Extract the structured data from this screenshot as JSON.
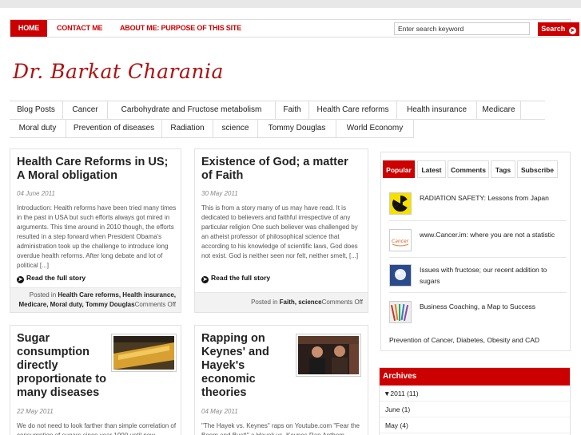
{
  "nav": {
    "home": "HOME",
    "contact": "CONTACT ME",
    "about": "ABOUT ME: PURPOSE OF THIS SITE",
    "search_placeholder": "Enter search keyword",
    "search_button": "Search"
  },
  "site_title": "Dr. Barkat Charania",
  "categories_row1": [
    "Blog Posts",
    "Cancer",
    "Carbohydrate and Fructose metabolism",
    "Faith",
    "Health Care reforms",
    "Health insurance",
    "Medicare"
  ],
  "categories_row2": [
    "Moral duty",
    "Prevention of diseases",
    "Radiation",
    "science",
    "Tommy Douglas",
    "World Economy"
  ],
  "posts": [
    {
      "title": "Health Care Reforms in US; A Moral obligation",
      "date": "04 June 2011",
      "excerpt": "Introduction: Health reforms have been tried many times in the past in USA but such efforts always got mired in arguments. This time around in 2010 though, the efforts resulted in a step forward when President Obama's administration took up the challenge to introduce long overdue health reforms. After long debate and lot of political [...]",
      "read_more": "Read the full story",
      "meta_prefix": "Posted in",
      "meta_cats": "Health Care reforms, Health insurance, Medicare, Moral duty, Tommy Douglas",
      "meta_comments": "Comments Off"
    },
    {
      "title": "Existence of God; a matter of Faith",
      "date": "30 May 2011",
      "excerpt": "This is from a story many of us may have read. It is dedicated to believers and faithful irrespective of any particular religion One such believer was challenged by an atheist professor of philosophical science that according to his knowledge of scientific laws, God does not exist. God is neither seen nor felt, neither smelt, [...]",
      "read_more": "Read the full story",
      "meta_prefix": "Posted in",
      "meta_cats": "Faith, science",
      "meta_comments": "Comments Off"
    },
    {
      "title": "Sugar consumption directly proportionate to many diseases",
      "date": "22 May 2011",
      "excerpt": "We do not need to look farther than simple correlation of consumption of sugars since year 1900 until now"
    },
    {
      "title": "Rapping on Keynes' and Hayek's economic theories",
      "date": "04 May 2011",
      "excerpt": "\"The Hayek vs. Keynes\" raps on Youtube.com  \"Fear the Boom and Bust\\\" a Hayek vs. Keynes Rap Anthem"
    }
  ],
  "sidebar": {
    "tabs": [
      "Popular",
      "Latest",
      "Comments",
      "Tags",
      "Subscribe"
    ],
    "popular": [
      {
        "title": "RADIATION SAFETY: Lessons from Japan",
        "icon": "radiation-icon"
      },
      {
        "title": "www.Cancer.im: where you are not a statistic",
        "icon": "cancer-logo-icon"
      },
      {
        "title": "Issues with fructose; our recent addition to sugars",
        "icon": "sugar-icon"
      },
      {
        "title": "Business Coaching, a Map to Success",
        "icon": "pencils-icon"
      }
    ],
    "prevention": "Prevention of Cancer, Diabetes, Obesity and CAD",
    "archives_title": "Archives",
    "archives": [
      "▼2011 (11)",
      "June (1)",
      "May (4)"
    ]
  },
  "colors": {
    "accent": "#cc0000",
    "title": "#b01010"
  }
}
